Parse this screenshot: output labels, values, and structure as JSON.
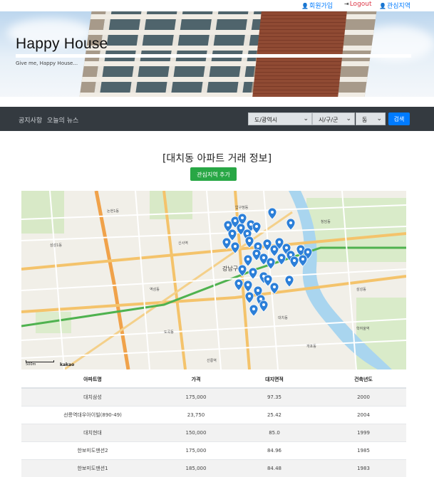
{
  "topbar": {
    "signup": "회원가입",
    "logout": "Logout",
    "favorite_area": "관심지역",
    "user_icon": "user-icon",
    "logout_icon": "logout-icon"
  },
  "hero": {
    "title": "Happy House",
    "tagline": "Give me, Happy House..."
  },
  "nav": {
    "links": [
      "공지사항",
      "오늘의 뉴스"
    ],
    "selects": {
      "sido": "도/광역시",
      "gugun": "시/구/군",
      "dong": "동"
    },
    "search_label": "검색"
  },
  "main": {
    "heading": "[대치동 아파트 거래 정보]",
    "add_favorite_label": "관심지역 추가"
  },
  "map": {
    "district_label": "강남구",
    "scale_label": "500m",
    "provider": "kakao",
    "marker_color": "#2c7fd8",
    "place_labels": [
      "삼성1동",
      "논현1동",
      "신사역",
      "청담동",
      "압구정동",
      "역삼동",
      "도곡동",
      "대치동",
      "개포동",
      "선릉역",
      "삼성동",
      "학여울역"
    ]
  },
  "table": {
    "headers": [
      "아파트명",
      "가격",
      "대지면적",
      "건축년도"
    ],
    "rows": [
      [
        "대치삼성",
        "175,000",
        "97.35",
        "2000"
      ],
      [
        "선릉역대우아이빌(890-49)",
        "23,750",
        "25.42",
        "2004"
      ],
      [
        "대치현대",
        "150,000",
        "85.0",
        "1999"
      ],
      [
        "한보미도맨션2",
        "175,000",
        "84.96",
        "1985"
      ],
      [
        "한보미도맨션1",
        "185,000",
        "84.48",
        "1983"
      ]
    ]
  }
}
